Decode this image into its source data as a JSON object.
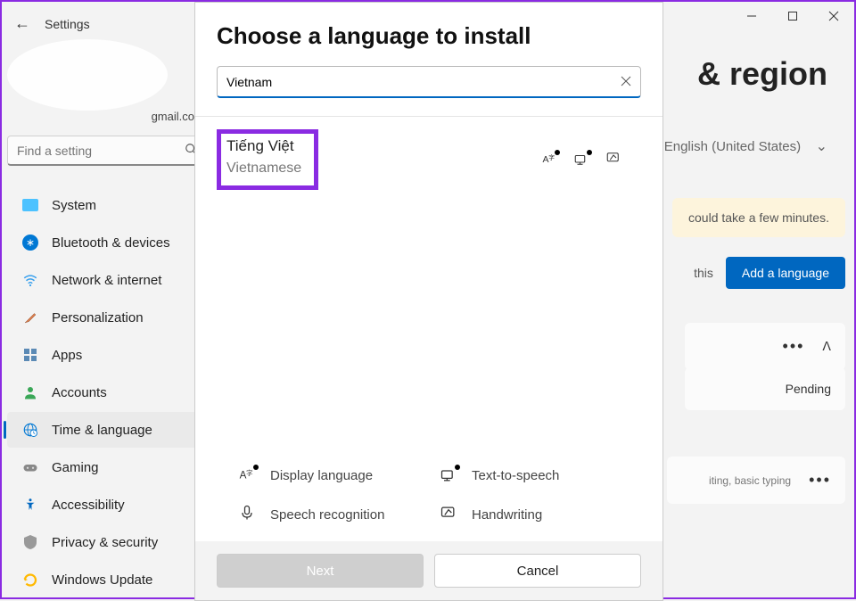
{
  "window": {
    "title": "Settings"
  },
  "profile": {
    "email_fragment": "gmail.co"
  },
  "search": {
    "placeholder": "Find a setting"
  },
  "sidebar": {
    "items": [
      {
        "label": "System"
      },
      {
        "label": "Bluetooth & devices"
      },
      {
        "label": "Network & internet"
      },
      {
        "label": "Personalization"
      },
      {
        "label": "Apps"
      },
      {
        "label": "Accounts"
      },
      {
        "label": "Time & language"
      },
      {
        "label": "Gaming"
      },
      {
        "label": "Accessibility"
      },
      {
        "label": "Privacy & security"
      },
      {
        "label": "Windows Update"
      }
    ]
  },
  "main": {
    "page_title_fragment": "& region",
    "display_lang": "English (United States)",
    "info_text": "could take a few minutes.",
    "pref_label_fragment": "this",
    "add_button": "Add a language",
    "pending_status": "Pending",
    "typing_fragment": "iting, basic typing"
  },
  "modal": {
    "title": "Choose a language to install",
    "search_value": "Vietnam",
    "result": {
      "native": "Tiếng Việt",
      "english": "Vietnamese"
    },
    "legend": {
      "display": "Display language",
      "tts": "Text-to-speech",
      "speech": "Speech recognition",
      "hand": "Handwriting"
    },
    "next_label": "Next",
    "cancel_label": "Cancel"
  }
}
